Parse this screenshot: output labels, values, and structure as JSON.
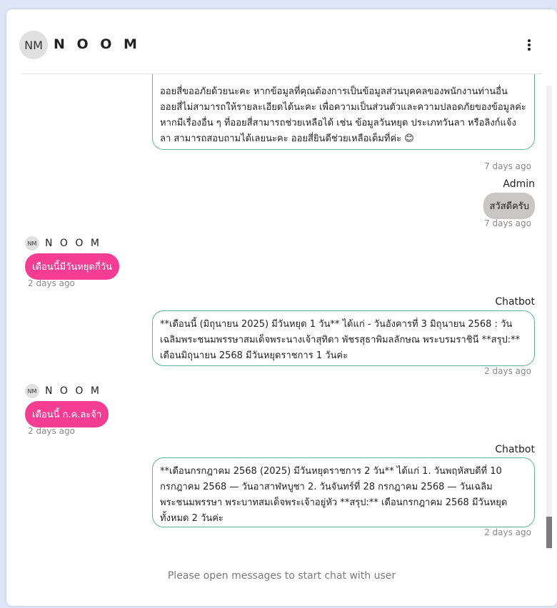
{
  "header": {
    "avatar_initials": "NM",
    "name": "N O O M",
    "menu_icon": "kebab-menu-icon"
  },
  "messages": [
    {
      "type": "outgoing",
      "text": "ออยสี่ขออภัยด้วยนะคะ หากข้อมูลที่คุณต้องการเป็นข้อมูลส่วนบุคคลของพนักงานท่านอื่น ออยสี่ไม่สามารถให้รายละเอียดได้นะคะ เพื่อความเป็นส่วนตัวและความปลอดภัยของข้อมูลค่ะ หากมีเรื่องอื่น ๆ ที่ออยสี่สามารถช่วยเหลือได้ เช่น ข้อมูลวันหยุด ประเภทวันลา หรือลิงก์แจ้งลา สามารถสอบถามได้เลยนะคะ ออยสี่ยินดีช่วยเหลือเต็มที่ค่ะ 😊",
      "time": "7 days ago"
    },
    {
      "type": "admin",
      "sender": "Admin",
      "text": "สวัสดีครับ",
      "time": "7 days ago"
    },
    {
      "type": "incoming",
      "avatar_initials": "NM",
      "sender": "N O O M",
      "text": "เดือนนี้มีวันหยุดกี่วัน",
      "time": "2 days ago"
    },
    {
      "type": "outgoing",
      "sender": "Chatbot",
      "text": "**เดือนนี้ (มิถุนายน 2025) มีวันหยุด 1 วัน** ได้แก่ - วันอังคารที่ 3 มิถุนายน 2568 : วันเฉลิมพระชนมพรรษาสมเด็จพระนางเจ้าสุทิดา พัชรสุธาพิมลลักษณ พระบรมราชินี **สรุป:** เดือนมิถุนายน 2568 มีวันหยุดราชการ 1 วันค่ะ",
      "time": "2 days ago"
    },
    {
      "type": "incoming",
      "avatar_initials": "NM",
      "sender": "N O O M",
      "text": "เดือนนี้ ก.ค.ละจ้า",
      "time": "2 days ago"
    },
    {
      "type": "outgoing",
      "sender": "Chatbot",
      "text": "**เดือนกรกฎาคม 2568 (2025) มีวันหยุดราชการ 2 วัน** ได้แก่ 1. วันพฤหัสบดีที่ 10 กรกฎาคม 2568 — วันอาสาฬหบูชา 2. วันจันทร์ที่ 28 กรกฎาคม 2568 — วันเฉลิมพระชนมพรรษา พระบาทสมเด็จพระเจ้าอยู่หัว **สรุป:** เดือนกรกฎาคม 2568 มีวันหยุดทั้งหมด 2 วันค่ะ",
      "time": "2 days ago"
    }
  ],
  "footer": {
    "text": "Please open messages to start chat with user"
  }
}
